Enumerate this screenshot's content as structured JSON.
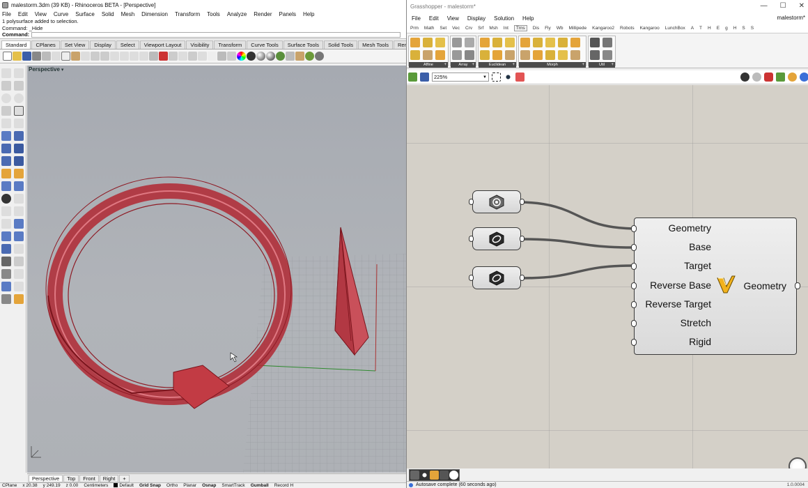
{
  "rhino": {
    "title": "malestorm.3dm (39 KB) - Rhinoceros BETA - [Perspective]",
    "menu": [
      "File",
      "Edit",
      "View",
      "Curve",
      "Surface",
      "Solid",
      "Mesh",
      "Dimension",
      "Transform",
      "Tools",
      "Analyze",
      "Render",
      "Panels",
      "Help"
    ],
    "command_history": [
      "1 polysurface added to selection.",
      "Command: _Hide"
    ],
    "command_prompt": "Command:",
    "command_value": "",
    "toolbar_tabs": [
      "Standard",
      "CPlanes",
      "Set View",
      "Display",
      "Select",
      "Viewport Layout",
      "Visibility",
      "Transform",
      "Curve Tools",
      "Surface Tools",
      "Solid Tools",
      "Mesh Tools",
      "Render Tools"
    ],
    "active_toolbar_tab": "Standard",
    "viewport_label": "Perspective",
    "viewport_caret": "▾",
    "view_tabs": [
      "Perspective",
      "Top",
      "Front",
      "Right",
      "+"
    ],
    "status": {
      "cplane": "CPlane",
      "x": "x 20.38",
      "y": "y 249.19",
      "z": "z 0.00",
      "units": "Centimeters",
      "layer": "Default",
      "toggles": [
        "Grid Snap",
        "Ortho",
        "Planar",
        "Osnap",
        "SmartTrack",
        "Gumball",
        "Record H"
      ]
    },
    "accent_color": "#c8323c"
  },
  "grasshopper": {
    "title": "Grasshopper - malestorm*",
    "window_buttons": [
      "—",
      "☐",
      "✕"
    ],
    "menu": [
      "File",
      "Edit",
      "View",
      "Display",
      "Solution",
      "Help"
    ],
    "document_name": "malestorm*",
    "tabs": [
      "Prm",
      "Math",
      "Set",
      "Vec",
      "Crv",
      "Srf",
      "Msh",
      "Int",
      "Trns",
      "Dis",
      "Fly",
      "Wb",
      "Millipede",
      "Kangaroo2",
      "Robots",
      "Kangaroo",
      "LunchBox",
      "A",
      "T",
      "H",
      "E",
      "g",
      "H",
      "S",
      "S"
    ],
    "active_tab": "Trns",
    "ribbon_groups": [
      "Affine",
      "Array",
      "Euclidean",
      "Morph",
      "Util"
    ],
    "zoom": "225%",
    "component": {
      "inputs": [
        "Geometry",
        "Base",
        "Target",
        "Reverse Base",
        "Reverse Target",
        "Stretch",
        "Rigid"
      ],
      "output": "Geometry",
      "icon": "orient-icon"
    },
    "status_message": "Autosave complete (60 seconds ago)",
    "version": "1.0.0004"
  }
}
